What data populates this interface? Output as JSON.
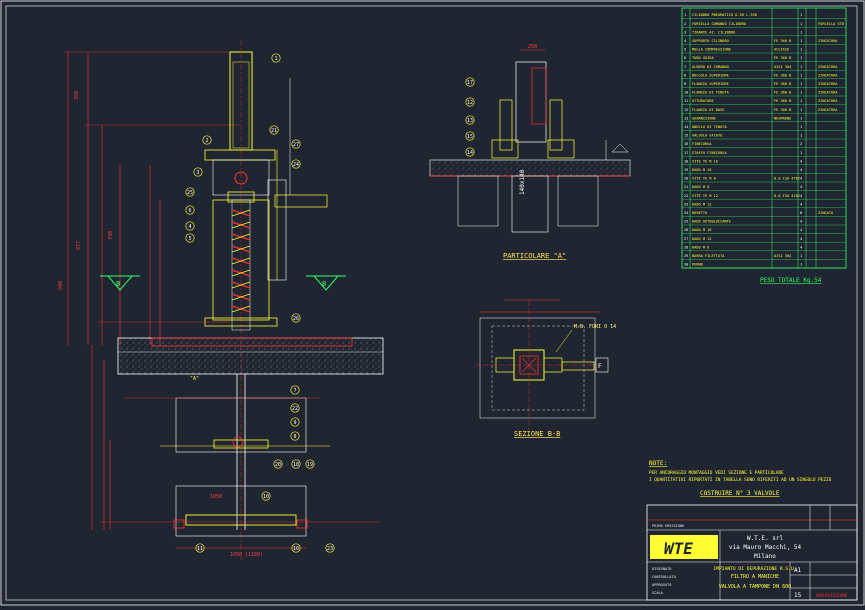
{
  "parts_list": {
    "rows": [
      {
        "n": "1",
        "desc": "CILINDRO PNEUMATICO D.50 L.350",
        "mat": "",
        "q": "1",
        "note": ""
      },
      {
        "n": "2",
        "desc": "FORCELLA COMANDO CILINDRO",
        "mat": "",
        "q": "1",
        "note": "FORCELLA STD"
      },
      {
        "n": "3",
        "desc": "TIRANTE AZ. CILINDRO",
        "mat": "",
        "q": "1",
        "note": ""
      },
      {
        "n": "4",
        "desc": "SUPPORTO CILINDRO",
        "mat": "FE 360 B",
        "q": "1",
        "note": "ZINCATURA"
      },
      {
        "n": "5",
        "desc": "MOLLA COMPRESSIONE",
        "mat": "ACCIAIO",
        "q": "1",
        "note": ""
      },
      {
        "n": "6",
        "desc": "TUBO GUIDA",
        "mat": "FE 360 B",
        "q": "1",
        "note": ""
      },
      {
        "n": "7",
        "desc": "ALBERO DI COMANDO",
        "mat": "AISI 304",
        "q": "1",
        "note": "ZINCATURA"
      },
      {
        "n": "8",
        "desc": "BOCCOLA SUPERIORE",
        "mat": "FE 360 B",
        "q": "1",
        "note": "ZINCATURA"
      },
      {
        "n": "9",
        "desc": "FLANGIA SUPERIORE",
        "mat": "FE 360 B",
        "q": "1",
        "note": "ZINCATURA"
      },
      {
        "n": "10",
        "desc": "FLANGIA DI TENUTA",
        "mat": "FE 360 B",
        "q": "1",
        "note": "ZINCATURA"
      },
      {
        "n": "11",
        "desc": "OTTURATORE",
        "mat": "FE 360 B",
        "q": "1",
        "note": "ZINCATURA"
      },
      {
        "n": "12",
        "desc": "FLANGIA DI BASE",
        "mat": "FE 360 B",
        "q": "1",
        "note": "ZINCATURA"
      },
      {
        "n": "13",
        "desc": "GUARNIZIONE",
        "mat": "NEOPRENE",
        "q": "1",
        "note": ""
      },
      {
        "n": "14",
        "desc": "ANELLO DI TENUTA",
        "mat": "",
        "q": "1",
        "note": ""
      },
      {
        "n": "15",
        "desc": "VALVOLA SFIATO",
        "mat": "",
        "q": "1",
        "note": ""
      },
      {
        "n": "16",
        "desc": "FINECORSA",
        "mat": "",
        "q": "2",
        "note": ""
      },
      {
        "n": "17",
        "desc": "STAFFA FINECORSA",
        "mat": "",
        "q": "1",
        "note": ""
      },
      {
        "n": "18",
        "desc": "VITE TE M 10",
        "mat": "",
        "q": "4",
        "note": ""
      },
      {
        "n": "19",
        "desc": "DADO M 10",
        "mat": "",
        "q": "4",
        "note": ""
      },
      {
        "n": "20",
        "desc": "VITE TE M 8",
        "mat": "8.8 ISO 4762",
        "q": "4",
        "note": ""
      },
      {
        "n": "21",
        "desc": "DADO M 8",
        "mat": "",
        "q": "4",
        "note": ""
      },
      {
        "n": "22",
        "desc": "VITE TE M 12",
        "mat": "8.8 ISO 4762",
        "q": "4",
        "note": ""
      },
      {
        "n": "23",
        "desc": "DADO M 12",
        "mat": "",
        "q": "4",
        "note": ""
      },
      {
        "n": "24",
        "desc": "ROSETTA",
        "mat": "",
        "q": "8",
        "note": "ZINCATA"
      },
      {
        "n": "25",
        "desc": "DADO AUTOBLOCCANTE",
        "mat": "",
        "q": "4",
        "note": ""
      },
      {
        "n": "26",
        "desc": "DADO M 16",
        "mat": "",
        "q": "4",
        "note": ""
      },
      {
        "n": "27",
        "desc": "DADO M 12",
        "mat": "",
        "q": "4",
        "note": ""
      },
      {
        "n": "28",
        "desc": "DADO M 8",
        "mat": "",
        "q": "4",
        "note": ""
      },
      {
        "n": "29",
        "desc": "BARRA FILETTATA",
        "mat": "AISI 304",
        "q": "1",
        "note": ""
      },
      {
        "n": "30",
        "desc": "PERNO",
        "mat": "",
        "q": "1",
        "note": ""
      }
    ],
    "weight_label": "PESO TOTALE Kg.54"
  },
  "views": {
    "detail_a_title": "PARTICOLARE \"A\"",
    "section_b_title": "SEZIONE B-B",
    "section_marker": "B",
    "detail_marker": "\"A\"",
    "mb_label": "M.B. FORI 0 14",
    "dim_140": "140x140"
  },
  "notes": {
    "header": "NOTE:",
    "line1": "PER ANCORAGGIO MONTAGGIO VEDI SEZIONE E PARTICOLARE",
    "line2": "I QUANTITATIVI RIPORTATI IN TABELLA SONO RIFERITI AD UN SINGOLO PEZZO",
    "construction": "COSTRUIRE N° 3 VALVOLE"
  },
  "title_block": {
    "logo": "WTE",
    "company": "W.T.E. srl",
    "address": "via Mauro Macchi, 54",
    "city": "Milano",
    "plant": "IMPIANTO DI DEPURAZIONE",
    "line1": "IMPIANTO DI DEPURAZIONE R.S.U.",
    "line2": "FILTRO A MANICHE",
    "drawing_title": "VALVOLA A TAMPONE DN 600",
    "format": "A1",
    "sheet": "15"
  },
  "balloons": [
    "1",
    "2",
    "3",
    "4",
    "5",
    "6",
    "7",
    "8",
    "9",
    "10",
    "11",
    "12",
    "13",
    "14",
    "15",
    "16",
    "17",
    "18",
    "19",
    "20",
    "21",
    "22",
    "23",
    "24",
    "25",
    "26",
    "27"
  ],
  "colors": {
    "background": "#1f2531",
    "line_white": "#ffffff",
    "line_yellow": "#ffff33",
    "line_red": "#ff3030",
    "line_green": "#33ff66",
    "line_cyan": "#33ffff"
  }
}
